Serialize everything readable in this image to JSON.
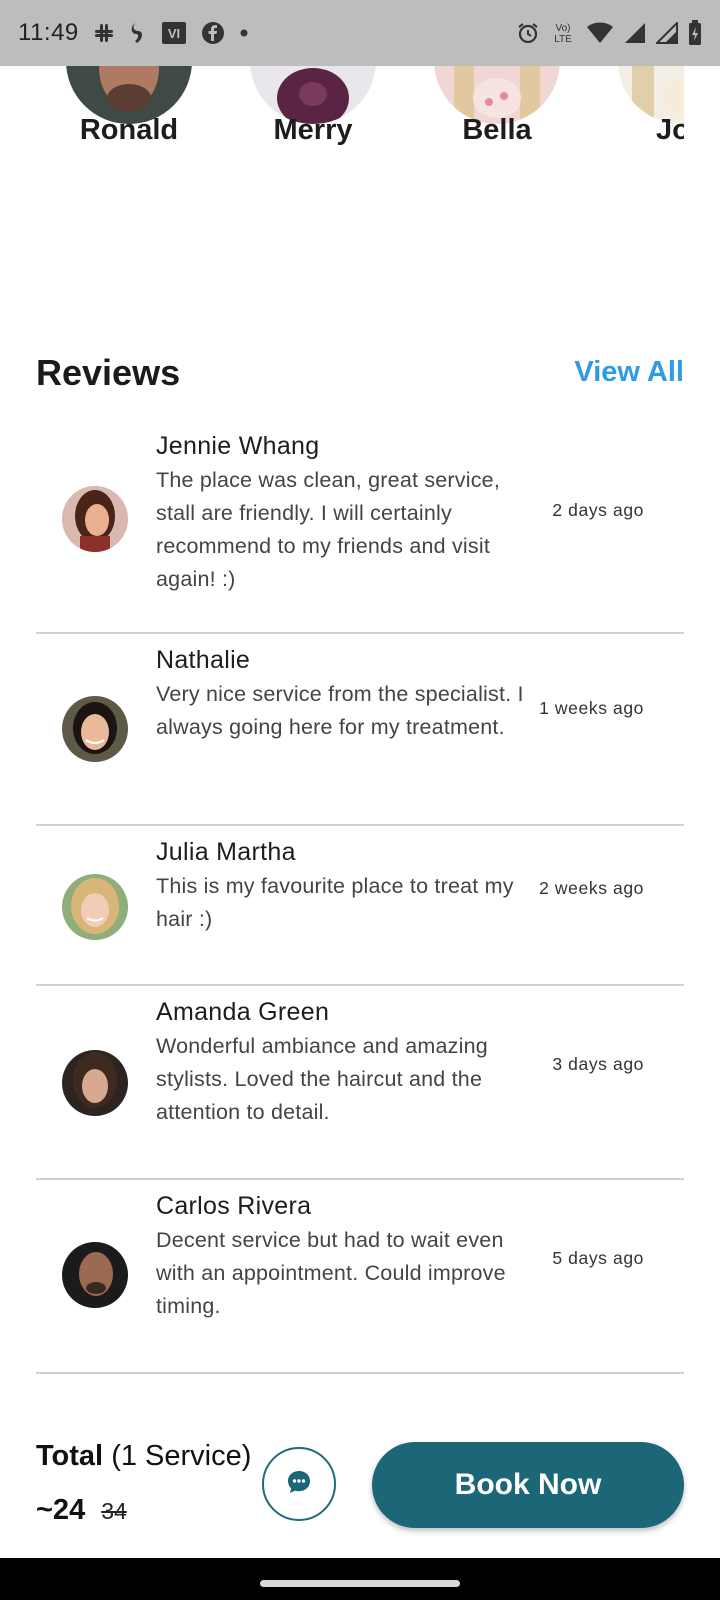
{
  "status_bar": {
    "time": "11:49",
    "left_icons": [
      "slack-icon",
      "gesture-icon",
      "vi-icon",
      "facebook-icon",
      "dot-icon"
    ],
    "vi_text": "VI",
    "network_text_top": "Vo)",
    "network_text_bottom": "LTE",
    "right_icons": [
      "alarm-icon",
      "volte-icon",
      "wifi-icon",
      "signal-icon",
      "signal-icon-2",
      "battery-icon"
    ]
  },
  "stylists": [
    {
      "name": "Ronald"
    },
    {
      "name": "Merry"
    },
    {
      "name": "Bella"
    },
    {
      "name": "Jos"
    }
  ],
  "reviews_section": {
    "title": "Reviews",
    "view_all": "View All"
  },
  "reviews": [
    {
      "name": "Jennie Whang",
      "text": "The place was clean, great service, stall are friendly. I will certainly recommend to my friends and visit again! :)",
      "time": "2 days ago"
    },
    {
      "name": "Nathalie",
      "text": "Very nice service from the specialist. I always going here for my treatment.",
      "time": "1 weeks ago"
    },
    {
      "name": "Julia Martha",
      "text": "This is my favourite place to treat my hair :)",
      "time": "2 weeks ago"
    },
    {
      "name": "Amanda Green",
      "text": "Wonderful ambiance and amazing stylists. Loved the haircut and the attention to detail.",
      "time": "3 days ago"
    },
    {
      "name": "Carlos Rivera",
      "text": "Decent service but had to wait even with an appointment. Could improve timing.",
      "time": "5 days ago"
    }
  ],
  "booking": {
    "total_label": "Total",
    "service_count": "(1 Service)",
    "price": "~24",
    "old_price": "34",
    "chat_icon": "chat-icon",
    "book_label": "Book Now"
  },
  "colors": {
    "accent": "#2f9be3",
    "primary": "#1c6777"
  }
}
